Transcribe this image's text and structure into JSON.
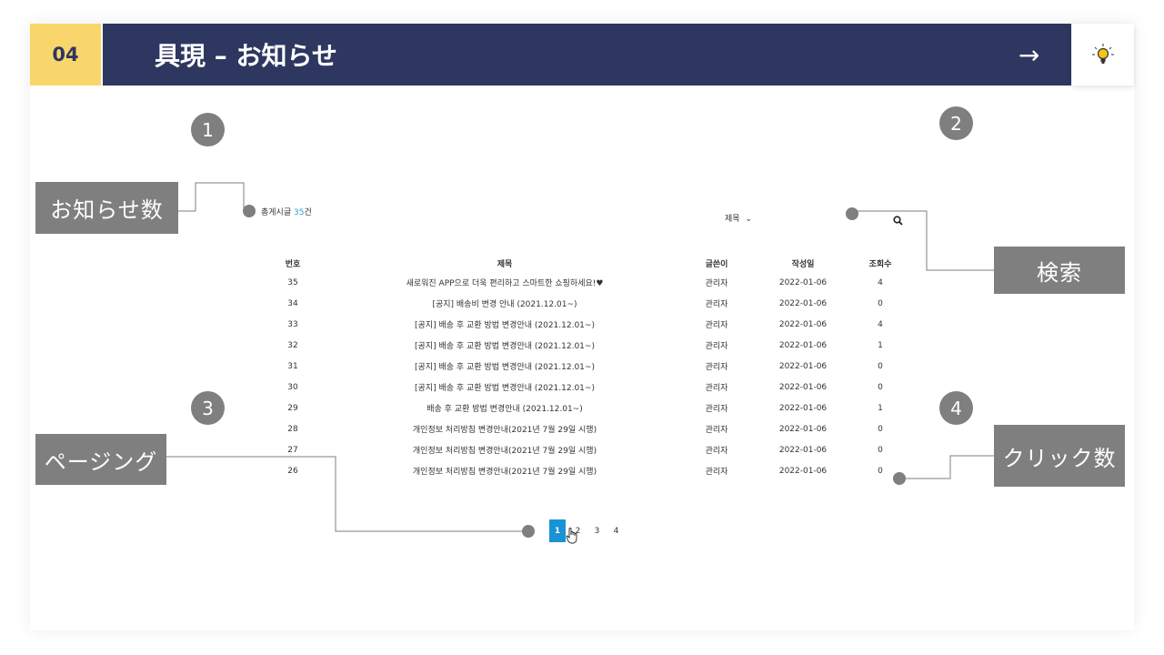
{
  "header": {
    "number": "04",
    "title": "具現 – お知らせ",
    "arrow": "→"
  },
  "markers": [
    "1",
    "2",
    "3",
    "4"
  ],
  "labels": {
    "notice_count": "お知らせ数",
    "search": "検索",
    "paging": "ページング",
    "click_count": "クリック数"
  },
  "board": {
    "total_prefix": "총게시글 ",
    "total_number": "35",
    "total_suffix": "건",
    "search_field": "제목",
    "columns": [
      "번호",
      "제목",
      "글쓴이",
      "작성일",
      "조회수"
    ],
    "rows": [
      [
        "35",
        "새로워진 APP으로 더욱 편리하고 스마트한 쇼핑하세요!♥",
        "관리자",
        "2022-01-06",
        "4"
      ],
      [
        "34",
        "[공지] 배송비 변경 안내 (2021.12.01~)",
        "관리자",
        "2022-01-06",
        "0"
      ],
      [
        "33",
        "[공지] 배송 후 교환 방법 변경안내 (2021.12.01~)",
        "관리자",
        "2022-01-06",
        "4"
      ],
      [
        "32",
        "[공지] 배송 후 교환 방법 변경안내 (2021.12.01~)",
        "관리자",
        "2022-01-06",
        "1"
      ],
      [
        "31",
        "[공지] 배송 후 교환 방법 변경안내 (2021.12.01~)",
        "관리자",
        "2022-01-06",
        "0"
      ],
      [
        "30",
        "[공지] 배송 후 교환 방법 변경안내 (2021.12.01~)",
        "관리자",
        "2022-01-06",
        "0"
      ],
      [
        "29",
        "배송 후 교환 방법 변경안내 (2021.12.01~)",
        "관리자",
        "2022-01-06",
        "1"
      ],
      [
        "28",
        "개인정보 처리방침 변경안내(2021년 7월 29일 시행)",
        "관리자",
        "2022-01-06",
        "0"
      ],
      [
        "27",
        "개인정보 처리방침 변경안내(2021년 7월 29일 시행)",
        "관리자",
        "2022-01-06",
        "0"
      ],
      [
        "26",
        "개인정보 처리방침 변경안내(2021년 7월 29일 시행)",
        "관리자",
        "2022-01-06",
        "0"
      ]
    ],
    "pages": [
      "1",
      "2",
      "3",
      "4"
    ],
    "current_page": "1"
  },
  "colors": {
    "header_bg": "#2e3760",
    "number_bg": "#f9d66b",
    "annotation_gray": "#7f7f7f",
    "pager_active": "#1a93d4",
    "count_accent": "#2aa0d8"
  }
}
